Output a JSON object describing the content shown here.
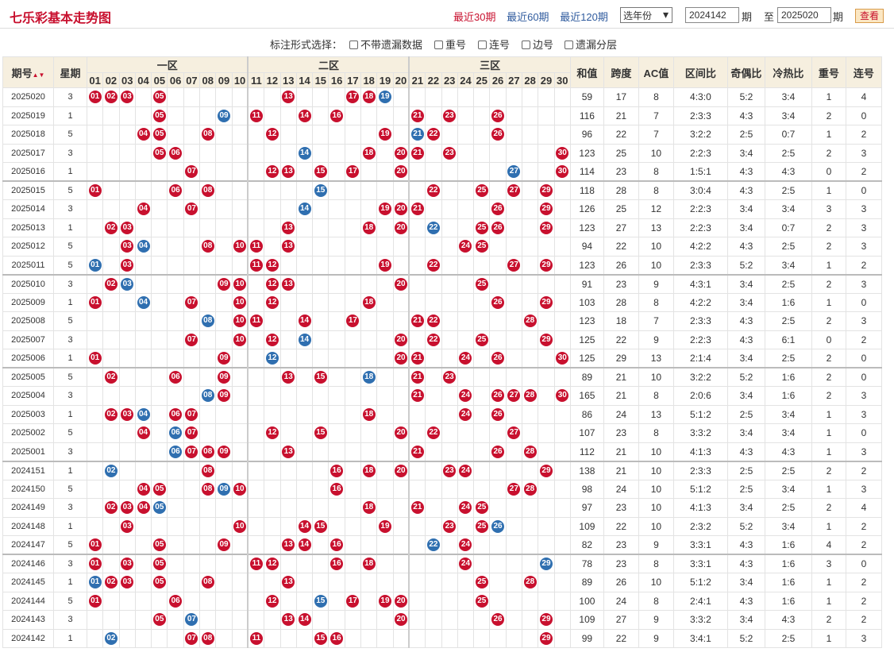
{
  "header": {
    "title": "七乐彩基本走势图",
    "periods": [
      "最近30期",
      "最近60期",
      "最近120期"
    ],
    "active_period": 0,
    "year_select": "选年份",
    "from_value": "2024142",
    "from_label": "期",
    "to_label": "至",
    "to_value": "2025020",
    "to_suffix": "期",
    "query_label": "查看"
  },
  "options": {
    "label": "标注形式选择：",
    "items": [
      "不带遗漏数据",
      "重号",
      "连号",
      "边号",
      "遗漏分层"
    ]
  },
  "table": {
    "col_period": "期号",
    "col_week": "星期",
    "zones": [
      "一区",
      "二区",
      "三区"
    ],
    "stat_cols": [
      "和值",
      "跨度",
      "AC值",
      "区间比",
      "奇偶比",
      "冷热比",
      "重号",
      "连号"
    ],
    "numbers": [
      "01",
      "02",
      "03",
      "04",
      "05",
      "06",
      "07",
      "08",
      "09",
      "10",
      "11",
      "12",
      "13",
      "14",
      "15",
      "16",
      "17",
      "18",
      "19",
      "20",
      "21",
      "22",
      "23",
      "24",
      "25",
      "26",
      "27",
      "28",
      "29",
      "30"
    ],
    "rows": [
      {
        "p": "2025020",
        "w": "3",
        "h": [
          1,
          2,
          3,
          5,
          13,
          17,
          18,
          19
        ],
        "x": [
          19
        ],
        "s": [
          "59",
          "17",
          "8",
          "4:3:0",
          "5:2",
          "3:4",
          "1",
          "4"
        ]
      },
      {
        "p": "2025019",
        "w": "1",
        "h": [
          5,
          9,
          11,
          14,
          16,
          21,
          23,
          26
        ],
        "x": [
          9
        ],
        "s": [
          "116",
          "21",
          "7",
          "2:3:3",
          "4:3",
          "3:4",
          "2",
          "0"
        ]
      },
      {
        "p": "2025018",
        "w": "5",
        "h": [
          4,
          5,
          8,
          12,
          19,
          21,
          22,
          26
        ],
        "x": [
          21
        ],
        "s": [
          "96",
          "22",
          "7",
          "3:2:2",
          "2:5",
          "0:7",
          "1",
          "2"
        ]
      },
      {
        "p": "2025017",
        "w": "3",
        "h": [
          5,
          6,
          14,
          18,
          20,
          21,
          23,
          30
        ],
        "x": [
          14
        ],
        "s": [
          "123",
          "25",
          "10",
          "2:2:3",
          "3:4",
          "2:5",
          "2",
          "3"
        ]
      },
      {
        "p": "2025016",
        "w": "1",
        "h": [
          7,
          12,
          13,
          15,
          17,
          20,
          27,
          30
        ],
        "x": [
          27
        ],
        "s": [
          "114",
          "23",
          "8",
          "1:5:1",
          "4:3",
          "4:3",
          "0",
          "2"
        ]
      },
      {
        "p": "2025015",
        "w": "5",
        "h": [
          1,
          6,
          8,
          15,
          22,
          25,
          27,
          29
        ],
        "x": [
          15
        ],
        "s": [
          "118",
          "28",
          "8",
          "3:0:4",
          "4:3",
          "2:5",
          "1",
          "0"
        ]
      },
      {
        "p": "2025014",
        "w": "3",
        "h": [
          4,
          7,
          14,
          19,
          20,
          21,
          26,
          29
        ],
        "x": [
          14
        ],
        "s": [
          "126",
          "25",
          "12",
          "2:2:3",
          "3:4",
          "3:4",
          "3",
          "3"
        ]
      },
      {
        "p": "2025013",
        "w": "1",
        "h": [
          2,
          3,
          13,
          18,
          20,
          22,
          25,
          26,
          29
        ],
        "x": [
          22
        ],
        "s": [
          "123",
          "27",
          "13",
          "2:2:3",
          "3:4",
          "0:7",
          "2",
          "3"
        ]
      },
      {
        "p": "2025012",
        "w": "5",
        "h": [
          3,
          4,
          8,
          10,
          11,
          13,
          24,
          25
        ],
        "x": [
          4
        ],
        "s": [
          "94",
          "22",
          "10",
          "4:2:2",
          "4:3",
          "2:5",
          "2",
          "3"
        ]
      },
      {
        "p": "2025011",
        "w": "5",
        "h": [
          1,
          3,
          11,
          12,
          19,
          22,
          27,
          29
        ],
        "x": [
          1
        ],
        "s": [
          "123",
          "26",
          "10",
          "2:3:3",
          "5:2",
          "3:4",
          "1",
          "2"
        ]
      },
      {
        "p": "2025010",
        "w": "3",
        "h": [
          2,
          3,
          9,
          10,
          12,
          13,
          20,
          25
        ],
        "x": [
          3
        ],
        "s": [
          "91",
          "23",
          "9",
          "4:3:1",
          "3:4",
          "2:5",
          "2",
          "3"
        ]
      },
      {
        "p": "2025009",
        "w": "1",
        "h": [
          1,
          4,
          7,
          10,
          12,
          18,
          26,
          29
        ],
        "x": [
          4
        ],
        "s": [
          "103",
          "28",
          "8",
          "4:2:2",
          "3:4",
          "1:6",
          "1",
          "0"
        ]
      },
      {
        "p": "2025008",
        "w": "5",
        "h": [
          8,
          10,
          11,
          14,
          17,
          21,
          22,
          28
        ],
        "x": [
          8
        ],
        "s": [
          "123",
          "18",
          "7",
          "2:3:3",
          "4:3",
          "2:5",
          "2",
          "3"
        ]
      },
      {
        "p": "2025007",
        "w": "3",
        "h": [
          7,
          10,
          12,
          14,
          20,
          22,
          25,
          29
        ],
        "x": [
          14
        ],
        "s": [
          "125",
          "22",
          "9",
          "2:2:3",
          "4:3",
          "6:1",
          "0",
          "2"
        ]
      },
      {
        "p": "2025006",
        "w": "1",
        "h": [
          1,
          9,
          12,
          20,
          21,
          24,
          26,
          30
        ],
        "x": [
          12
        ],
        "s": [
          "125",
          "29",
          "13",
          "2:1:4",
          "3:4",
          "2:5",
          "2",
          "0"
        ]
      },
      {
        "p": "2025005",
        "w": "5",
        "h": [
          2,
          6,
          9,
          13,
          15,
          18,
          21,
          23
        ],
        "x": [
          18
        ],
        "s": [
          "89",
          "21",
          "10",
          "3:2:2",
          "5:2",
          "1:6",
          "2",
          "0"
        ]
      },
      {
        "p": "2025004",
        "w": "3",
        "h": [
          8,
          9,
          21,
          24,
          26,
          27,
          28,
          30
        ],
        "x": [
          8
        ],
        "s": [
          "165",
          "21",
          "8",
          "2:0:6",
          "3:4",
          "1:6",
          "2",
          "3"
        ]
      },
      {
        "p": "2025003",
        "w": "1",
        "h": [
          2,
          3,
          4,
          6,
          7,
          18,
          24,
          26
        ],
        "x": [
          4
        ],
        "s": [
          "86",
          "24",
          "13",
          "5:1:2",
          "2:5",
          "3:4",
          "1",
          "3"
        ]
      },
      {
        "p": "2025002",
        "w": "5",
        "h": [
          4,
          6,
          7,
          12,
          15,
          20,
          22,
          27
        ],
        "x": [
          6
        ],
        "s": [
          "107",
          "23",
          "8",
          "3:3:2",
          "3:4",
          "3:4",
          "1",
          "0"
        ]
      },
      {
        "p": "2025001",
        "w": "3",
        "h": [
          6,
          7,
          8,
          9,
          13,
          21,
          26,
          28
        ],
        "x": [
          6
        ],
        "s": [
          "112",
          "21",
          "10",
          "4:1:3",
          "4:3",
          "4:3",
          "1",
          "3"
        ]
      },
      {
        "p": "2024151",
        "w": "1",
        "h": [
          2,
          8,
          16,
          18,
          20,
          23,
          24,
          29
        ],
        "x": [
          2
        ],
        "s": [
          "138",
          "21",
          "10",
          "2:3:3",
          "2:5",
          "2:5",
          "2",
          "2"
        ]
      },
      {
        "p": "2024150",
        "w": "5",
        "h": [
          4,
          5,
          8,
          9,
          10,
          16,
          27,
          28
        ],
        "x": [
          9
        ],
        "s": [
          "98",
          "24",
          "10",
          "5:1:2",
          "2:5",
          "3:4",
          "1",
          "3"
        ]
      },
      {
        "p": "2024149",
        "w": "3",
        "h": [
          2,
          3,
          4,
          5,
          18,
          21,
          24,
          25
        ],
        "x": [
          5
        ],
        "s": [
          "97",
          "23",
          "10",
          "4:1:3",
          "3:4",
          "2:5",
          "2",
          "4"
        ]
      },
      {
        "p": "2024148",
        "w": "1",
        "h": [
          3,
          10,
          14,
          15,
          19,
          23,
          25,
          26
        ],
        "x": [
          26
        ],
        "s": [
          "109",
          "22",
          "10",
          "2:3:2",
          "5:2",
          "3:4",
          "1",
          "2"
        ]
      },
      {
        "p": "2024147",
        "w": "5",
        "h": [
          1,
          5,
          9,
          13,
          14,
          16,
          22,
          24
        ],
        "x": [
          22
        ],
        "s": [
          "82",
          "23",
          "9",
          "3:3:1",
          "4:3",
          "1:6",
          "4",
          "2"
        ]
      },
      {
        "p": "2024146",
        "w": "3",
        "h": [
          1,
          3,
          5,
          11,
          12,
          16,
          18,
          24,
          29
        ],
        "x": [
          29
        ],
        "s": [
          "78",
          "23",
          "8",
          "3:3:1",
          "4:3",
          "1:6",
          "3",
          "0"
        ]
      },
      {
        "p": "2024145",
        "w": "1",
        "h": [
          1,
          2,
          3,
          5,
          8,
          13,
          25,
          28
        ],
        "x": [
          1
        ],
        "s": [
          "89",
          "26",
          "10",
          "5:1:2",
          "3:4",
          "1:6",
          "1",
          "2"
        ]
      },
      {
        "p": "2024144",
        "w": "5",
        "h": [
          1,
          6,
          12,
          15,
          17,
          19,
          20,
          25
        ],
        "x": [
          15
        ],
        "s": [
          "100",
          "24",
          "8",
          "2:4:1",
          "4:3",
          "1:6",
          "1",
          "2"
        ]
      },
      {
        "p": "2024143",
        "w": "3",
        "h": [
          5,
          7,
          13,
          14,
          20,
          26,
          29
        ],
        "x": [
          7
        ],
        "s": [
          "109",
          "27",
          "9",
          "3:3:2",
          "3:4",
          "4:3",
          "2",
          "2"
        ]
      },
      {
        "p": "2024142",
        "w": "1",
        "h": [
          2,
          7,
          8,
          11,
          15,
          16,
          29
        ],
        "x": [
          2
        ],
        "s": [
          "99",
          "22",
          "9",
          "3:4:1",
          "5:2",
          "2:5",
          "1",
          "3"
        ]
      }
    ]
  }
}
